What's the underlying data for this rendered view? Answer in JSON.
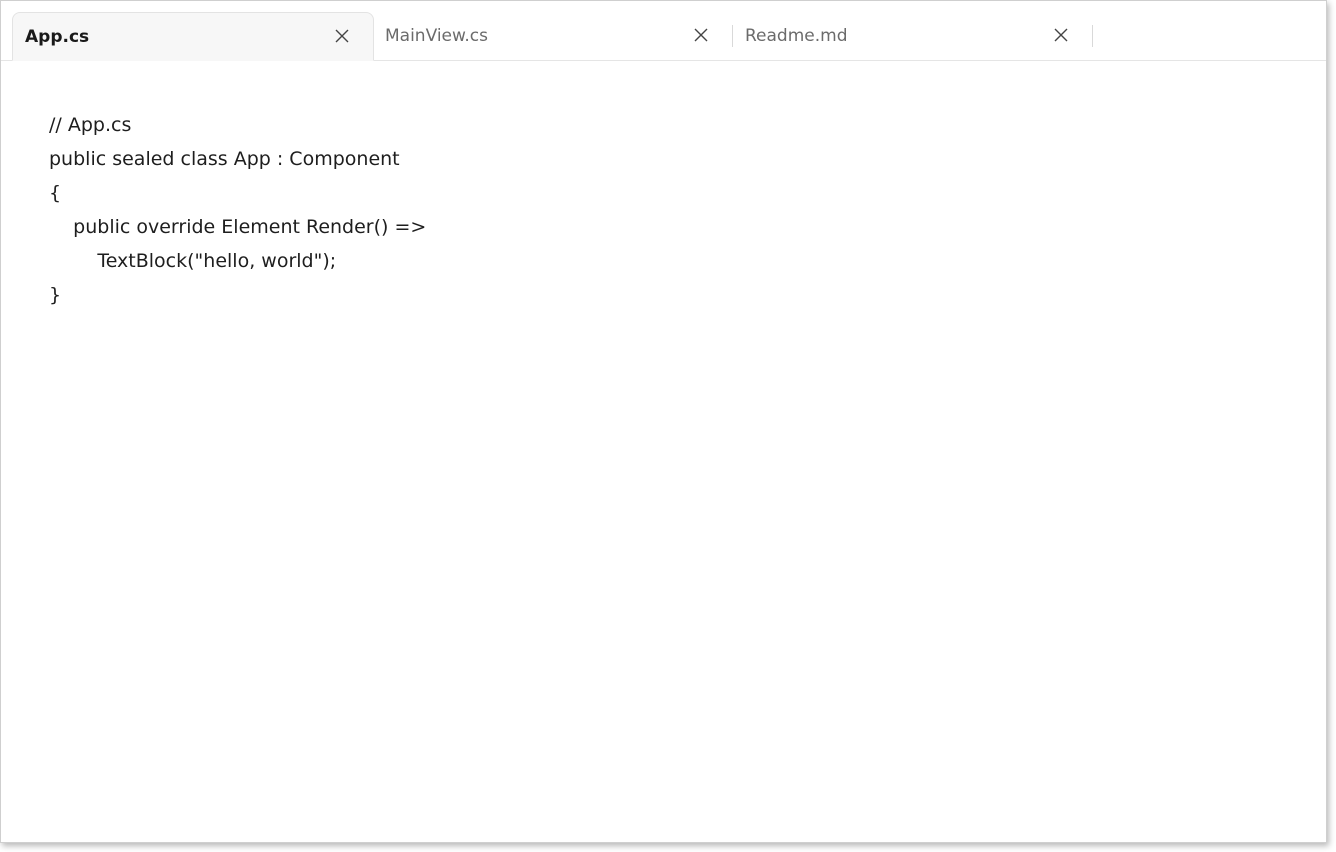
{
  "tabs": [
    {
      "label": "App.cs",
      "active": true,
      "close_icon": "close-icon"
    },
    {
      "label": "MainView.cs",
      "active": false,
      "close_icon": "close-icon"
    },
    {
      "label": "Readme.md",
      "active": false,
      "close_icon": "close-icon"
    }
  ],
  "editor": {
    "lines": [
      "// App.cs",
      "public sealed class App : Component",
      "{",
      "    public override Element Render() =>",
      "        TextBlock(\"hello, world\");",
      "}"
    ]
  },
  "colors": {
    "active_tab_bg": "#f7f7f7",
    "inactive_tab_text": "#6b6b6b",
    "active_tab_text": "#1a1a1a",
    "code_text": "#1e1e1e"
  }
}
